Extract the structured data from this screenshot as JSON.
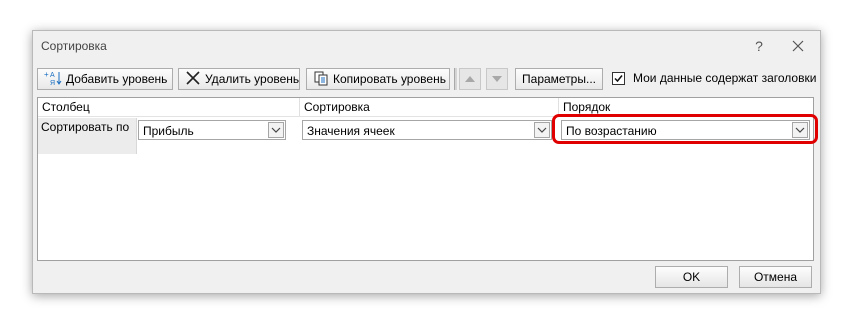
{
  "dialog": {
    "title": "Сортировка",
    "help": "?"
  },
  "toolbar": {
    "add_level": "Добавить уровень",
    "delete_level": "Удалить уровень",
    "copy_level": "Копировать уровень",
    "options": "Параметры..."
  },
  "header_checkbox": {
    "label": "Мои данные содержат заголовки",
    "checked": true
  },
  "grid": {
    "columns": [
      "Столбец",
      "Сортировка",
      "Порядок"
    ],
    "rows": [
      {
        "label": "Сортировать по",
        "column": "Прибыль",
        "sort_on": "Значения ячеек",
        "order": "По возрастанию"
      }
    ]
  },
  "buttons": {
    "ok": "OK",
    "cancel": "Отмена"
  },
  "colors": {
    "highlight": "#e00000"
  }
}
